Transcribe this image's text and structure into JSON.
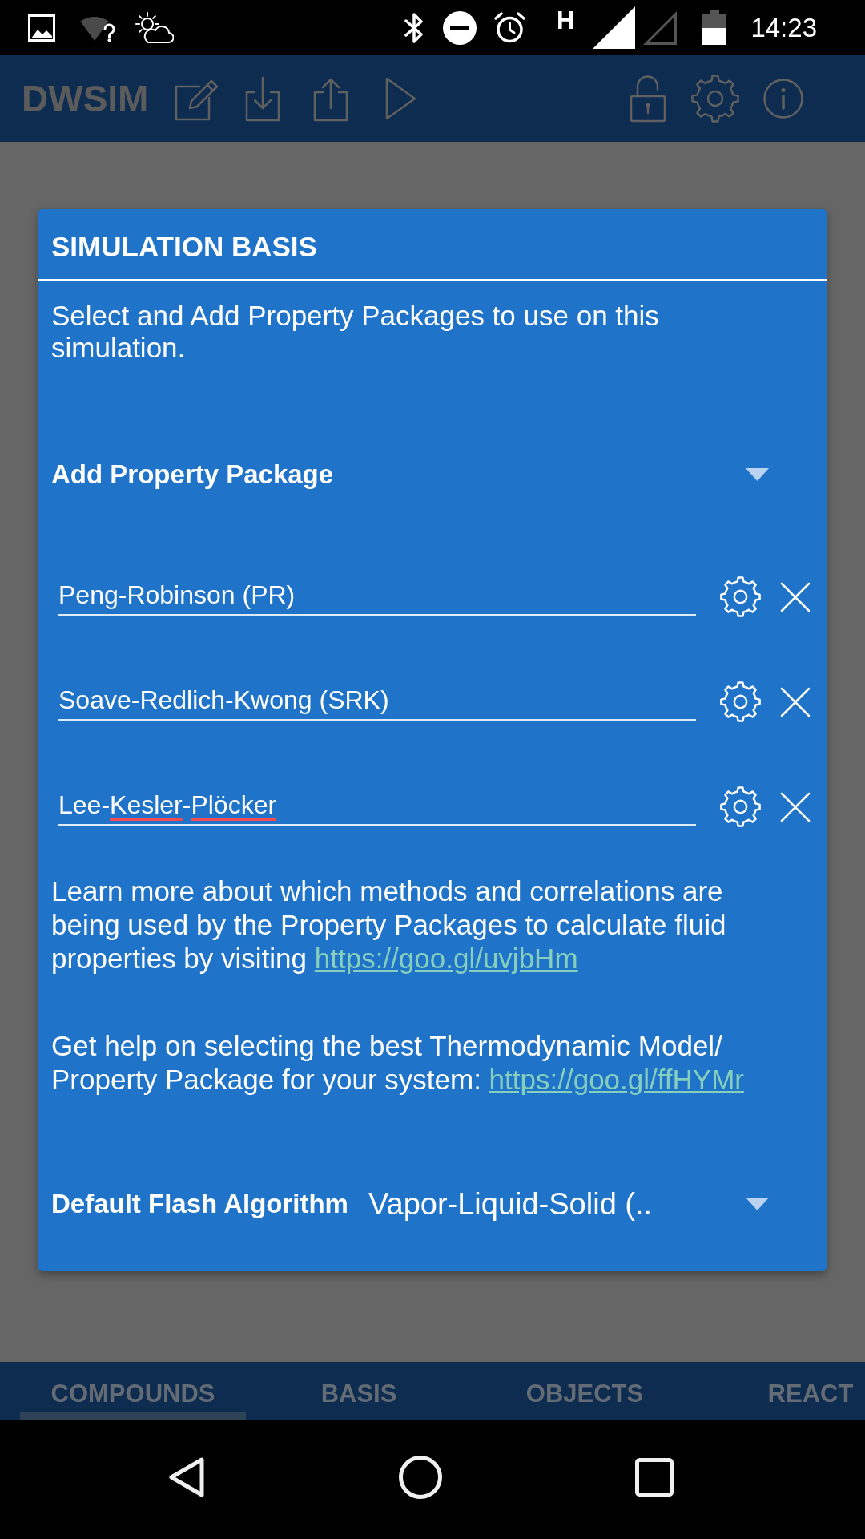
{
  "status_bar": {
    "network_type": "H",
    "time": "14:23"
  },
  "toolbar": {
    "title": "DWSIM"
  },
  "dialog": {
    "title": "SIMULATION BASIS",
    "description": "Select and Add Property Packages to use on this simulation.",
    "add_package": {
      "label": "Add Property Package"
    },
    "packages": [
      {
        "value_parts": [
          {
            "text": "Peng-Robinson (PR)",
            "misspelled": false
          }
        ]
      },
      {
        "value_parts": [
          {
            "text": "Soave-Redlich-Kwong (SRK)",
            "misspelled": false
          }
        ]
      },
      {
        "value_parts": [
          {
            "text": "Lee-",
            "misspelled": false
          },
          {
            "text": "Kesler",
            "misspelled": true
          },
          {
            "text": "-",
            "misspelled": false
          },
          {
            "text": "Plöcker",
            "misspelled": true
          }
        ]
      }
    ],
    "info_paragraphs": [
      {
        "text": "Learn more about which methods and correlations are being used by the Property Packages to calculate fluid properties by visiting",
        "link": "https://goo.gl/uvjbHm"
      },
      {
        "text": "Get help on selecting the best Thermodynamic Model/ Property Package for your system:",
        "link": "https://goo.gl/ffHYMr"
      }
    ],
    "flash_algorithm": {
      "label": "Default Flash Algorithm",
      "value": "Vapor-Liquid-Solid (.."
    }
  },
  "tabs": [
    {
      "label": "COMPOUNDS",
      "selected": true
    },
    {
      "label": "BASIS",
      "selected": false
    },
    {
      "label": "OBJECTS",
      "selected": false
    },
    {
      "label": "REACT",
      "selected": false
    }
  ]
}
